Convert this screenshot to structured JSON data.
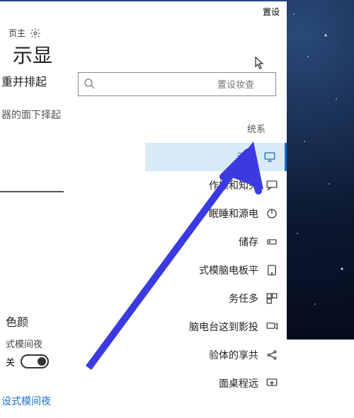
{
  "title": "置设",
  "header": {
    "home_label": "页主"
  },
  "page_title": "示显",
  "subheader1": "重并排起",
  "subheader2": "器的面下择起",
  "search": {
    "placeholder": "置设妆查"
  },
  "system_section_label": "统系",
  "sidebar": {
    "items": [
      {
        "label": "示显"
      },
      {
        "label": "作操和知央"
      },
      {
        "label": "眠睡和源电"
      },
      {
        "label": "储存"
      },
      {
        "label": "式模脑电板平"
      },
      {
        "label": "务任多"
      },
      {
        "label": "脑电台这到影投"
      },
      {
        "label": "验体的享共"
      },
      {
        "label": "面桌程远"
      }
    ]
  },
  "toggle": {
    "title": "色颜",
    "sub": "式模间夜",
    "state": "关"
  },
  "bottom_link": "设式模间夜"
}
